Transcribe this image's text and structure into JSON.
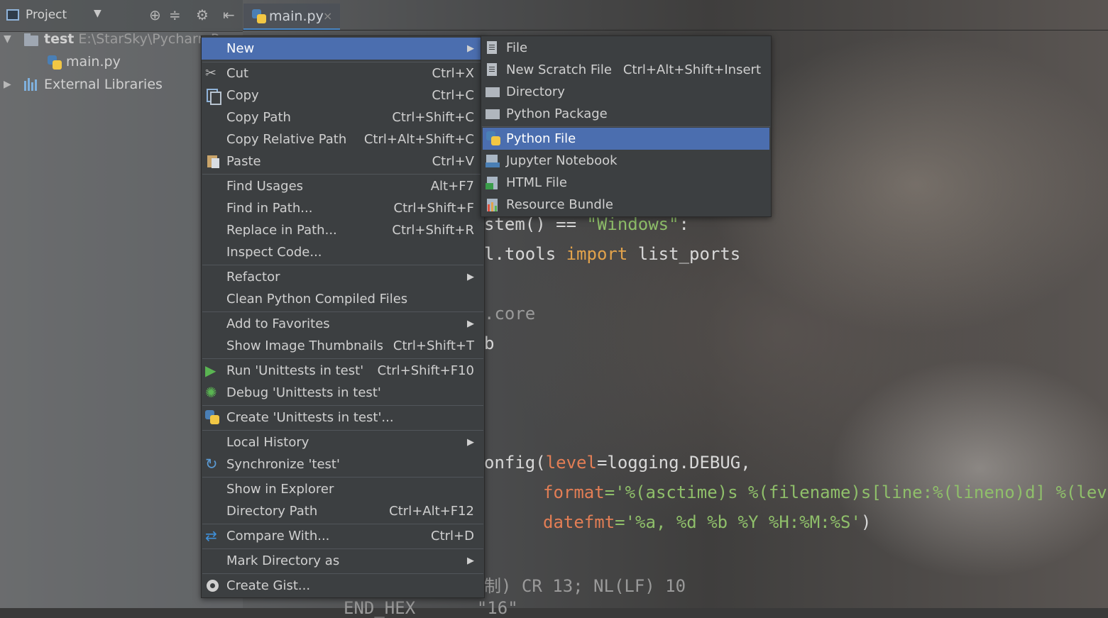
{
  "panel": {
    "title": "Project",
    "tree": {
      "root_name": "test",
      "root_path": "E:\\StarSky\\PycharmP",
      "file": "main.py",
      "libraries": "External Libraries"
    }
  },
  "editor": {
    "tab": "main.py",
    "tab_close": "×",
    "code": {
      "l1": "stem() == ",
      "l1_str": "\"Windows\"",
      "l1_end": ":",
      "l2_a": "l.tools ",
      "l2_kw": "import",
      "l2_b": " list_ports",
      "l3": ".core",
      "l4": "b",
      "l5_a": "onfig(",
      "l5_param": "level",
      "l5_b": "=logging.DEBUG,",
      "l6_param": "format",
      "l6_str": "='%(asctime)s %(filename)s[line:%(lineno)d] %(level",
      "l7_param": "datefmt",
      "l7_str": "='%a, %d %b %Y %H:%M:%S'",
      "l7_end": ")",
      "l8": "制) CR 13; NL(LF) 10",
      "l9": "END_HEX      \"16\""
    }
  },
  "context_menu": {
    "new": "New",
    "cut": "Cut",
    "cut_sc": "Ctrl+X",
    "copy": "Copy",
    "copy_sc": "Ctrl+C",
    "copy_path": "Copy Path",
    "copy_path_sc": "Ctrl+Shift+C",
    "copy_relative_path": "Copy Relative Path",
    "copy_relative_path_sc": "Ctrl+Alt+Shift+C",
    "paste": "Paste",
    "paste_sc": "Ctrl+V",
    "find_usages": "Find Usages",
    "find_usages_sc": "Alt+F7",
    "find_in_path": "Find in Path...",
    "find_in_path_sc": "Ctrl+Shift+F",
    "replace_in_path": "Replace in Path...",
    "replace_in_path_sc": "Ctrl+Shift+R",
    "inspect_code": "Inspect Code...",
    "refactor": "Refactor",
    "clean_python": "Clean Python Compiled Files",
    "add_favorites": "Add to Favorites",
    "show_thumbnails": "Show Image Thumbnails",
    "show_thumbnails_sc": "Ctrl+Shift+T",
    "run_unittests": "Run 'Unittests in test'",
    "run_unittests_sc": "Ctrl+Shift+F10",
    "debug_unittests": "Debug 'Unittests in test'",
    "create_unittests": "Create 'Unittests in test'...",
    "local_history": "Local History",
    "synchronize": "Synchronize 'test'",
    "show_in_explorer": "Show in Explorer",
    "directory_path": "Directory Path",
    "directory_path_sc": "Ctrl+Alt+F12",
    "compare_with": "Compare With...",
    "compare_with_sc": "Ctrl+D",
    "mark_directory": "Mark Directory as",
    "create_gist": "Create Gist..."
  },
  "submenu": {
    "file": "File",
    "new_scratch": "New Scratch File",
    "new_scratch_sc": "Ctrl+Alt+Shift+Insert",
    "directory": "Directory",
    "python_package": "Python Package",
    "python_file": "Python File",
    "jupyter": "Jupyter Notebook",
    "html_file": "HTML File",
    "resource_bundle": "Resource Bundle"
  },
  "colors": {
    "menu_bg": "#3c3f41",
    "selection": "#4b6eaf",
    "accent": "#4a88c7"
  }
}
